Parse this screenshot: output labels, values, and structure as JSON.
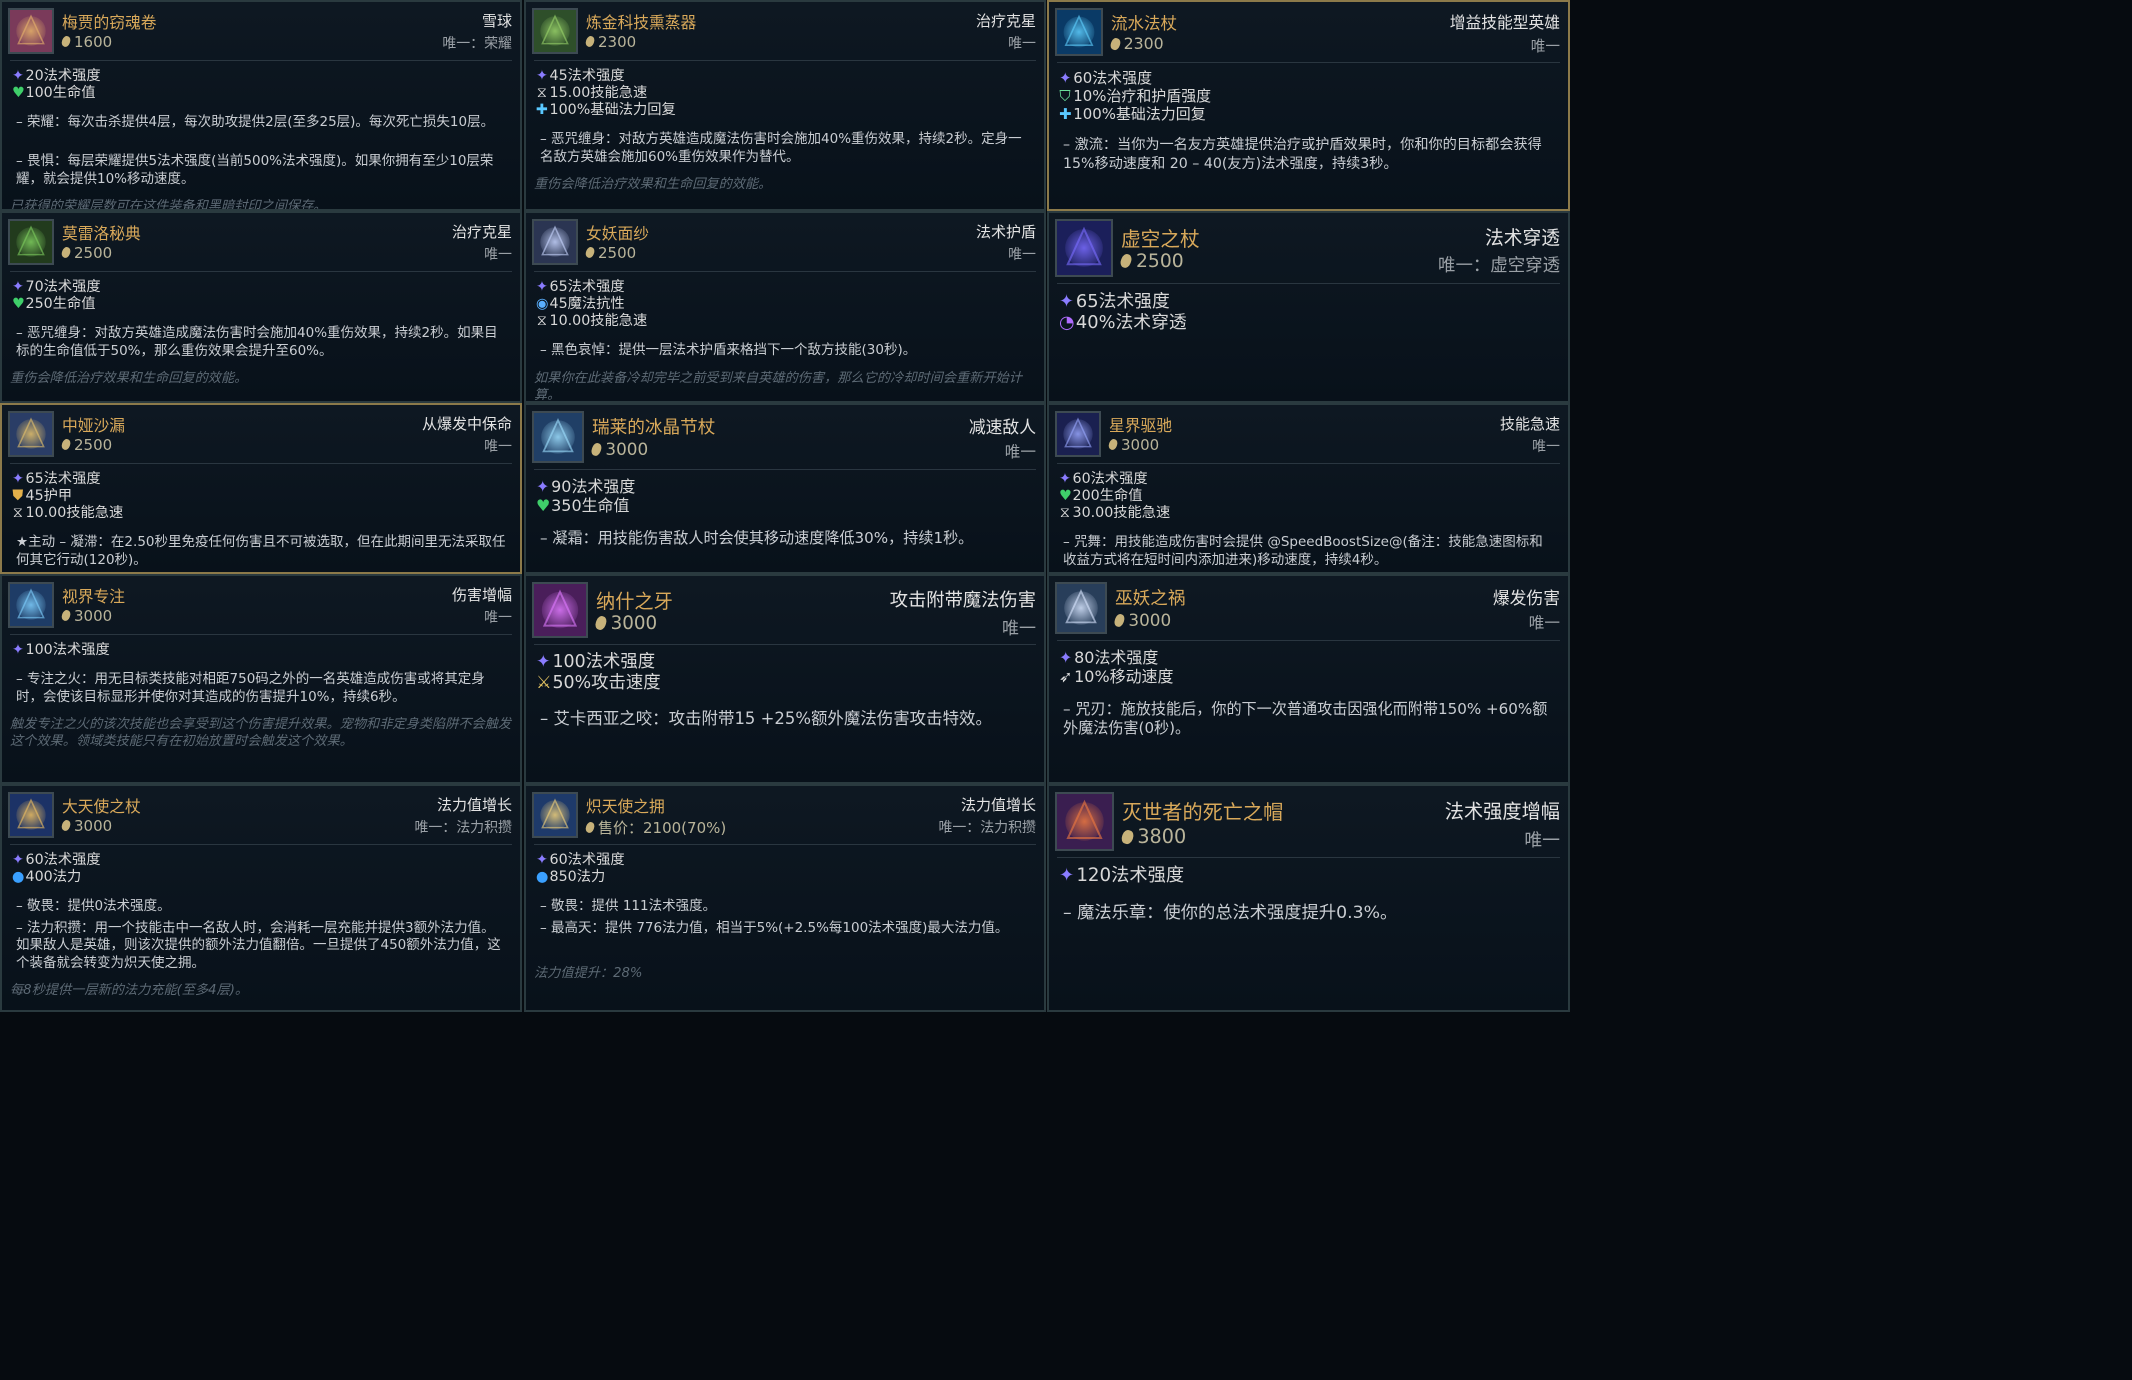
{
  "cards": [
    {
      "name": "梅贾的窃魂卷",
      "cost": "1600",
      "tag": "雪球",
      "unique": "唯一：荣耀",
      "icon_name": "scroll-icon",
      "stats": [
        {
          "icon": "ap",
          "text": "20法术强度"
        },
        {
          "icon": "hp",
          "text": "100生命值"
        }
      ],
      "passives": [
        "– 荣耀：每次击杀提供4层，每次助攻提供2层(至多25层)。每次死亡损失10层。",
        "– 畏惧：每层荣耀提供5法术强度(当前500%法术强度)。如果你拥有至少10层荣耀，就会提供10%移动速度。"
      ],
      "flavor": "已获得的荣耀层数可在这件装备和黑暗封印之间保存。"
    },
    {
      "name": "炼金科技熏蒸器",
      "cost": "2300",
      "tag": "治疗克星",
      "unique": "唯一",
      "icon_name": "censer-icon",
      "stats": [
        {
          "icon": "ap",
          "text": "45法术强度"
        },
        {
          "icon": "haste",
          "text": "15.00技能急速"
        },
        {
          "icon": "regen",
          "text": "100%基础法力回复"
        }
      ],
      "passives": [
        "– 恶咒缠身：对敌方英雄造成魔法伤害时会施加40%重伤效果，持续2秒。定身一名敌方英雄会施加60%重伤效果作为替代。"
      ],
      "flavor": "重伤会降低治疗效果和生命回复的效能。"
    },
    {
      "name": "流水法杖",
      "cost": "2300",
      "tag": "增益技能型英雄",
      "unique": "唯一",
      "icon_name": "vortex-icon",
      "stats": [
        {
          "icon": "ap",
          "text": "60法术强度"
        },
        {
          "icon": "heal",
          "text": "10%治疗和护盾强度"
        },
        {
          "icon": "regen",
          "text": "100%基础法力回复"
        }
      ],
      "passives": [
        "– 激流：当你为一名友方英雄提供治疗或护盾效果时，你和你的目标都会获得15%移动速度和 20 – 40(友方)法术强度，持续3秒。"
      ],
      "flavor": ""
    },
    {
      "name": "莫雷洛秘典",
      "cost": "2500",
      "tag": "治疗克星",
      "unique": "唯一",
      "icon_name": "tome-icon",
      "stats": [
        {
          "icon": "ap",
          "text": "70法术强度"
        },
        {
          "icon": "hp",
          "text": "250生命值"
        }
      ],
      "passives": [
        "– 恶咒缠身：对敌方英雄造成魔法伤害时会施加40%重伤效果，持续2秒。如果目标的生命值低于50%，那么重伤效果会提升至60%。"
      ],
      "flavor": "重伤会降低治疗效果和生命回复的效能。"
    },
    {
      "name": "女妖面纱",
      "cost": "2500",
      "tag": "法术护盾",
      "unique": "唯一",
      "icon_name": "veil-icon",
      "stats": [
        {
          "icon": "ap",
          "text": "65法术强度"
        },
        {
          "icon": "mr",
          "text": "45魔法抗性"
        },
        {
          "icon": "haste",
          "text": "10.00技能急速"
        }
      ],
      "passives": [
        "– 黑色哀悼：提供一层法术护盾来格挡下一个敌方技能(30秒)。"
      ],
      "flavor": "如果你在此装备冷却完毕之前受到来自英雄的伤害，那么它的冷却时间会重新开始计算。"
    },
    {
      "name": "虚空之杖",
      "cost": "2500",
      "tag": "法术穿透",
      "unique": "唯一：虚空穿透",
      "icon_name": "void-staff-icon",
      "stats": [
        {
          "icon": "ap",
          "text": "65法术强度"
        },
        {
          "icon": "pen",
          "text": "40%法术穿透"
        }
      ],
      "passives": [],
      "flavor": ""
    },
    {
      "name": "中娅沙漏",
      "cost": "2500",
      "tag": "从爆发中保命",
      "unique": "唯一",
      "icon_name": "hourglass-icon",
      "stats": [
        {
          "icon": "ap",
          "text": "65法术强度"
        },
        {
          "icon": "armor",
          "text": "45护甲"
        },
        {
          "icon": "haste",
          "text": "10.00技能急速"
        }
      ],
      "passives": [
        "★主动 – 凝滞：在2.50秒里免疫任何伤害且不可被选取，但在此期间里无法采取任何其它行动(120秒)。"
      ],
      "flavor": ""
    },
    {
      "name": "瑞莱的冰晶节杖",
      "cost": "3000",
      "tag": "减速敌人",
      "unique": "唯一",
      "icon_name": "ice-scepter-icon",
      "stats": [
        {
          "icon": "ap",
          "text": "90法术强度"
        },
        {
          "icon": "hp",
          "text": "350生命值"
        }
      ],
      "passives": [
        "– 凝霜：用技能伤害敌人时会使其移动速度降低30%，持续1秒。"
      ],
      "flavor": ""
    },
    {
      "name": "星界驱驰",
      "cost": "3000",
      "tag": "技能急速",
      "unique": "唯一",
      "icon_name": "astral-icon",
      "stats": [
        {
          "icon": "ap",
          "text": "60法术强度"
        },
        {
          "icon": "hp",
          "text": "200生命值"
        },
        {
          "icon": "haste",
          "text": "30.00技能急速"
        }
      ],
      "passives": [
        "– 咒舞：用技能造成伤害时会提供 @SpeedBoostSize@(备注：技能急速图标和收益方式将在短时间内添加进来)移动速度，持续4秒。"
      ],
      "flavor": ""
    },
    {
      "name": "视界专注",
      "cost": "3000",
      "tag": "伤害增幅",
      "unique": "唯一",
      "icon_name": "focus-icon",
      "stats": [
        {
          "icon": "ap",
          "text": "100法术强度"
        }
      ],
      "passives": [
        "– 专注之火：用无目标类技能对相距750码之外的一名英雄造成伤害或将其定身时，会使该目标显形并使你对其造成的伤害提升10%，持续6秒。"
      ],
      "flavor": "触发专注之火的该次技能也会享受到这个伤害提升效果。宠物和非定身类陷阱不会触发这个效果。领域类技能只有在初始放置时会触发这个效果。"
    },
    {
      "name": "纳什之牙",
      "cost": "3000",
      "tag": "攻击附带魔法伤害",
      "unique": "唯一",
      "icon_name": "fang-icon",
      "stats": [
        {
          "icon": "ap",
          "text": "100法术强度"
        },
        {
          "icon": "as",
          "text": "50%攻击速度"
        }
      ],
      "passives": [
        "– 艾卡西亚之咬：攻击附带15 +25%额外魔法伤害攻击特效。"
      ],
      "flavor": ""
    },
    {
      "name": "巫妖之祸",
      "cost": "3000",
      "tag": "爆发伤害",
      "unique": "唯一",
      "icon_name": "lich-bane-icon",
      "stats": [
        {
          "icon": "ap",
          "text": "80法术强度"
        },
        {
          "icon": "ms",
          "text": "10%移动速度"
        }
      ],
      "passives": [
        "– 咒刃：施放技能后，你的下一次普通攻击因强化而附带150% +60%额外魔法伤害(0秒)。"
      ],
      "flavor": ""
    },
    {
      "name": "大天使之杖",
      "cost": "3000",
      "tag": "法力值增长",
      "unique": "唯一：法力积攒",
      "icon_name": "archangel-staff-icon",
      "stats": [
        {
          "icon": "ap",
          "text": "60法术强度"
        },
        {
          "icon": "mana",
          "text": "400法力"
        }
      ],
      "passives": [
        "– 敬畏：提供0法术强度。",
        "– 法力积攒：用一个技能击中一名敌人时，会消耗一层充能并提供3额外法力值。如果敌人是英雄，则该次提供的额外法力值翻倍。一旦提供了450额外法力值，这个装备就会转变为炽天使之拥。"
      ],
      "flavor": "每8秒提供一层新的法力充能(至多4层)。"
    },
    {
      "name": "炽天使之拥",
      "cost": "售价：2100(70%)",
      "tag": "法力值增长",
      "unique": "唯一：法力积攒",
      "icon_name": "seraph-icon",
      "stats": [
        {
          "icon": "ap",
          "text": "60法术强度"
        },
        {
          "icon": "mana",
          "text": "850法力"
        }
      ],
      "passives": [
        "– 敬畏：提供 111法术强度。",
        "– 最高天：提供 776法力值，相当于5%(+2.5%每100法术强度)最大法力值。"
      ],
      "flavor": "法力值提升：28%"
    },
    {
      "name": "灭世者的死亡之帽",
      "cost": "3800",
      "tag": "法术强度增幅",
      "unique": "唯一",
      "icon_name": "deathcap-icon",
      "stats": [
        {
          "icon": "ap",
          "text": "120法术强度"
        }
      ],
      "passives": [
        "– 魔法乐章：使你的总法术强度提升0.3%。"
      ],
      "flavor": ""
    }
  ]
}
